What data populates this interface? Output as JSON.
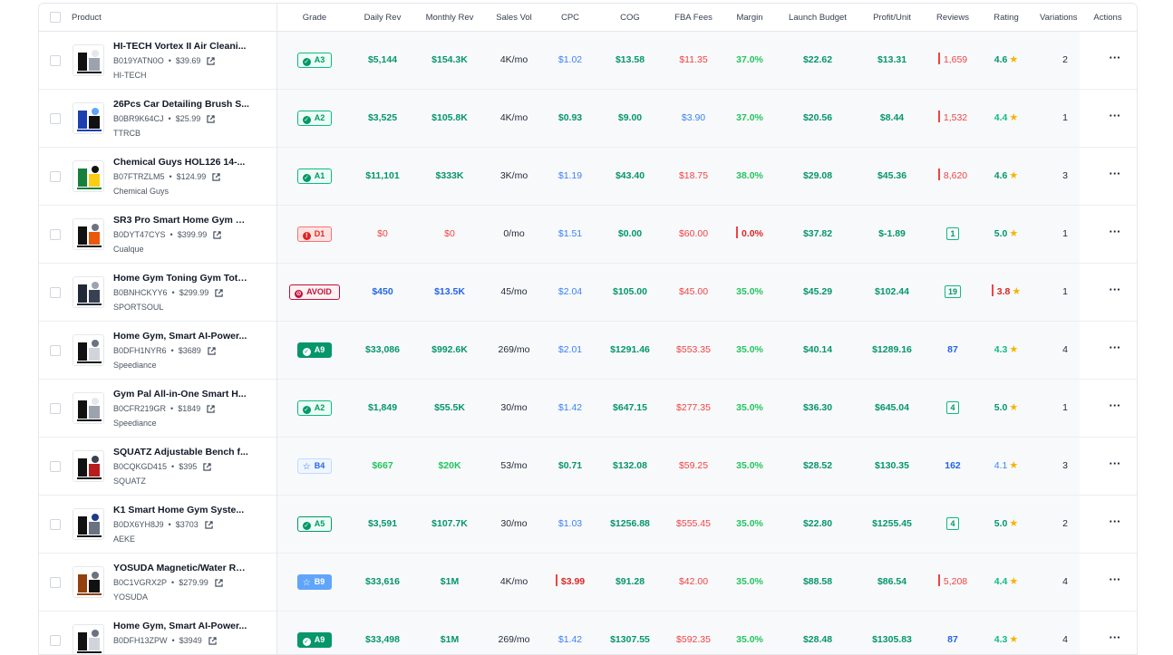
{
  "columns": {
    "product": "Product",
    "grade": "Grade",
    "daily": "Daily Rev",
    "monthly": "Monthly Rev",
    "sales": "Sales Vol",
    "cpc": "CPC",
    "cog": "COG",
    "fba": "FBA Fees",
    "margin": "Margin",
    "launch": "Launch Budget",
    "profit": "Profit/Unit",
    "reviews": "Reviews",
    "rating": "Rating",
    "variations": "Variations",
    "actions": "Actions"
  },
  "colors": {
    "green": "#059669",
    "red": "#dc2626",
    "blue": "#2563eb",
    "star": "#f5b301"
  },
  "rows": [
    {
      "name": "HI-TECH Vortex II Air Cleani...",
      "asin": "B019YATN0O",
      "price": "$39.69",
      "brand": "HI-TECH",
      "grade": "A3",
      "grade_style": "outline-green",
      "daily": "$5,144",
      "daily_c": "green",
      "monthly": "$154.3K",
      "monthly_c": "green",
      "sales": "4K/mo",
      "cpc": "$1.02",
      "cpc_c": "lblue",
      "cog": "$13.58",
      "fba": "$11.35",
      "fba_c": "red-thin",
      "margin": "37.0%",
      "margin_c": "lgreen-thin",
      "launch": "$22.62",
      "profit": "$13.31",
      "reviews": "1,659",
      "reviews_style": "bar-red",
      "rating": "4.6",
      "rating_c": "green",
      "variations": "2"
    },
    {
      "name": "26Pcs Car Detailing Brush S...",
      "asin": "B0BR9K64CJ",
      "price": "$25.99",
      "brand": "TTRCB",
      "grade": "A2",
      "grade_style": "outline-green",
      "daily": "$3,525",
      "daily_c": "green",
      "monthly": "$105.8K",
      "monthly_c": "green",
      "sales": "4K/mo",
      "cpc": "$0.93",
      "cpc_c": "green",
      "cog": "$9.00",
      "fba": "$3.90",
      "fba_c": "lblue",
      "margin": "37.0%",
      "margin_c": "lgreen-thin",
      "launch": "$20.56",
      "profit": "$8.44",
      "reviews": "1,532",
      "reviews_style": "bar-red",
      "rating": "4.4",
      "rating_c": "lgreen",
      "variations": "1"
    },
    {
      "name": "Chemical Guys HOL126 14-...",
      "asin": "B07FTRZLM5",
      "price": "$124.99",
      "brand": "Chemical Guys",
      "grade": "A1",
      "grade_style": "outline-green",
      "daily": "$11,101",
      "daily_c": "green",
      "monthly": "$333K",
      "monthly_c": "green",
      "sales": "3K/mo",
      "cpc": "$1.19",
      "cpc_c": "lblue",
      "cog": "$43.40",
      "fba": "$18.75",
      "fba_c": "red-thin",
      "margin": "38.0%",
      "margin_c": "lgreen-thin",
      "launch": "$29.08",
      "profit": "$45.36",
      "reviews": "8,620",
      "reviews_style": "bar-red",
      "rating": "4.6",
      "rating_c": "green",
      "variations": "3"
    },
    {
      "name": "SR3 Pro Smart Home Gym E...",
      "asin": "B0DYT47CYS",
      "price": "$399.99",
      "brand": "Cualque",
      "grade": "D1",
      "grade_style": "red",
      "daily": "$0",
      "daily_c": "red-thin",
      "monthly": "$0",
      "monthly_c": "red-thin",
      "sales": "0/mo",
      "cpc": "$1.51",
      "cpc_c": "lblue",
      "cog": "$0.00",
      "fba": "$60.00",
      "fba_c": "red-thin",
      "margin": "0.0%",
      "margin_c": "red-bar",
      "launch": "$37.82",
      "profit": "$-1.89",
      "reviews": "1",
      "reviews_style": "boxed",
      "rating": "5.0",
      "rating_c": "green",
      "variations": "1"
    },
    {
      "name": "Home Gym Toning Gym Tota...",
      "asin": "B0BNHCKYY6",
      "price": "$299.99",
      "brand": "SPORTSOUL",
      "grade": "AVOID",
      "grade_style": "avoid",
      "daily": "$450",
      "daily_c": "blue",
      "monthly": "$13.5K",
      "monthly_c": "blue",
      "sales": "45/mo",
      "cpc": "$2.04",
      "cpc_c": "lblue",
      "cog": "$105.00",
      "fba": "$45.00",
      "fba_c": "red-thin",
      "margin": "35.0%",
      "margin_c": "lgreen-thin",
      "launch": "$45.29",
      "profit": "$102.44",
      "reviews": "19",
      "reviews_style": "boxed",
      "rating": "3.8",
      "rating_c": "red-bar",
      "variations": "1"
    },
    {
      "name": "Home Gym, Smart AI-Power...",
      "asin": "B0DFH1NYR6",
      "price": "$3689",
      "brand": "Speediance",
      "grade": "A9",
      "grade_style": "solid-green",
      "daily": "$33,086",
      "daily_c": "green",
      "monthly": "$992.6K",
      "monthly_c": "green",
      "sales": "269/mo",
      "cpc": "$2.01",
      "cpc_c": "lblue",
      "cog": "$1291.46",
      "fba": "$553.35",
      "fba_c": "red-thin",
      "margin": "35.0%",
      "margin_c": "lgreen-thin",
      "launch": "$40.14",
      "profit": "$1289.16",
      "reviews": "87",
      "reviews_style": "blue",
      "rating": "4.3",
      "rating_c": "lgreen",
      "variations": "4"
    },
    {
      "name": "Gym Pal All-in-One Smart H...",
      "asin": "B0CFR219GR",
      "price": "$1849",
      "brand": "Speediance",
      "grade": "A2",
      "grade_style": "outline-green",
      "daily": "$1,849",
      "daily_c": "green",
      "monthly": "$55.5K",
      "monthly_c": "green",
      "sales": "30/mo",
      "cpc": "$1.42",
      "cpc_c": "lblue",
      "cog": "$647.15",
      "fba": "$277.35",
      "fba_c": "red-thin",
      "margin": "35.0%",
      "margin_c": "lgreen-thin",
      "launch": "$36.30",
      "profit": "$645.04",
      "reviews": "4",
      "reviews_style": "boxed",
      "rating": "5.0",
      "rating_c": "green",
      "variations": "1"
    },
    {
      "name": "SQUATZ Adjustable Bench f...",
      "asin": "B0CQKGD415",
      "price": "$395",
      "brand": "SQUATZ",
      "grade": "B4",
      "grade_style": "blue",
      "daily": "$667",
      "daily_c": "lgreen-thin",
      "monthly": "$20K",
      "monthly_c": "lgreen-thin",
      "sales": "53/mo",
      "cpc": "$0.71",
      "cpc_c": "green",
      "cog": "$132.08",
      "fba": "$59.25",
      "fba_c": "red-thin",
      "margin": "35.0%",
      "margin_c": "lgreen-thin",
      "launch": "$28.52",
      "profit": "$130.35",
      "reviews": "162",
      "reviews_style": "blue",
      "rating": "4.1",
      "rating_c": "lblue",
      "variations": "3"
    },
    {
      "name": "K1 Smart Home Gym Syste...",
      "asin": "B0DX6YH8J9",
      "price": "$3703",
      "brand": "AEKE",
      "grade": "A5",
      "grade_style": "outline-green-strong",
      "daily": "$3,591",
      "daily_c": "green",
      "monthly": "$107.7K",
      "monthly_c": "green",
      "sales": "30/mo",
      "cpc": "$1.03",
      "cpc_c": "lblue",
      "cog": "$1256.88",
      "fba": "$555.45",
      "fba_c": "red-thin",
      "margin": "35.0%",
      "margin_c": "lgreen-thin",
      "launch": "$22.80",
      "profit": "$1255.45",
      "reviews": "4",
      "reviews_style": "boxed",
      "rating": "5.0",
      "rating_c": "green",
      "variations": "2"
    },
    {
      "name": "YOSUDA Magnetic/Water Ro...",
      "asin": "B0C1VGRX2P",
      "price": "$279.99",
      "brand": "YOSUDA",
      "grade": "B9",
      "grade_style": "solid-blue",
      "daily": "$33,616",
      "daily_c": "green",
      "monthly": "$1M",
      "monthly_c": "green",
      "sales": "4K/mo",
      "cpc": "$3.99",
      "cpc_c": "red-bar",
      "cog": "$91.28",
      "fba": "$42.00",
      "fba_c": "red-thin",
      "margin": "35.0%",
      "margin_c": "lgreen-thin",
      "launch": "$88.58",
      "profit": "$86.54",
      "reviews": "5,208",
      "reviews_style": "bar-red",
      "rating": "4.4",
      "rating_c": "lgreen",
      "variations": "4"
    },
    {
      "name": "Home Gym, Smart AI-Power...",
      "asin": "B0DFH13ZPW",
      "price": "$3949",
      "brand": "",
      "grade": "A9",
      "grade_style": "solid-green",
      "daily": "$33,498",
      "daily_c": "green",
      "monthly": "$1M",
      "monthly_c": "green",
      "sales": "269/mo",
      "cpc": "$1.42",
      "cpc_c": "lblue",
      "cog": "$1307.55",
      "fba": "$592.35",
      "fba_c": "red-thin",
      "margin": "35.0%",
      "margin_c": "lgreen-thin",
      "launch": "$28.48",
      "profit": "$1305.83",
      "reviews": "87",
      "reviews_style": "blue",
      "rating": "4.3",
      "rating_c": "lgreen",
      "variations": "4"
    }
  ]
}
